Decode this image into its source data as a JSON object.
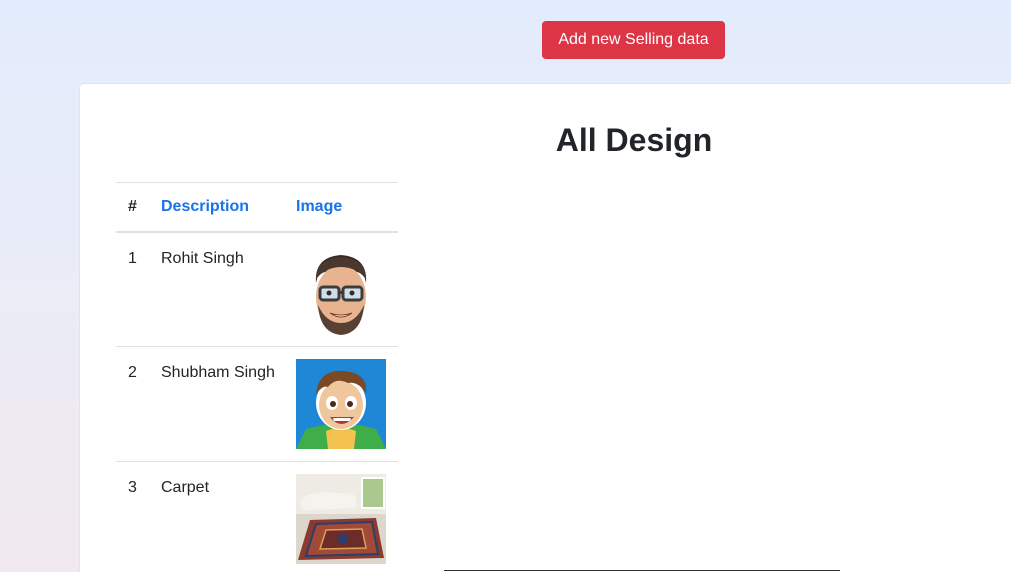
{
  "header": {
    "add_button_label": "Add new Selling data"
  },
  "main": {
    "title": "All Design",
    "table": {
      "columns": [
        "#",
        "Description",
        "Image"
      ],
      "rows": [
        {
          "num": "1",
          "description": "Rohit Singh",
          "image": "avatar-glasses-man"
        },
        {
          "num": "2",
          "description": "Shubham Singh",
          "image": "avatar-cartoon-boy"
        },
        {
          "num": "3",
          "description": "Carpet",
          "image": "carpet-photo"
        }
      ]
    }
  },
  "colors": {
    "accent_button": "#dc3545",
    "header_link": "#1a73e8"
  }
}
